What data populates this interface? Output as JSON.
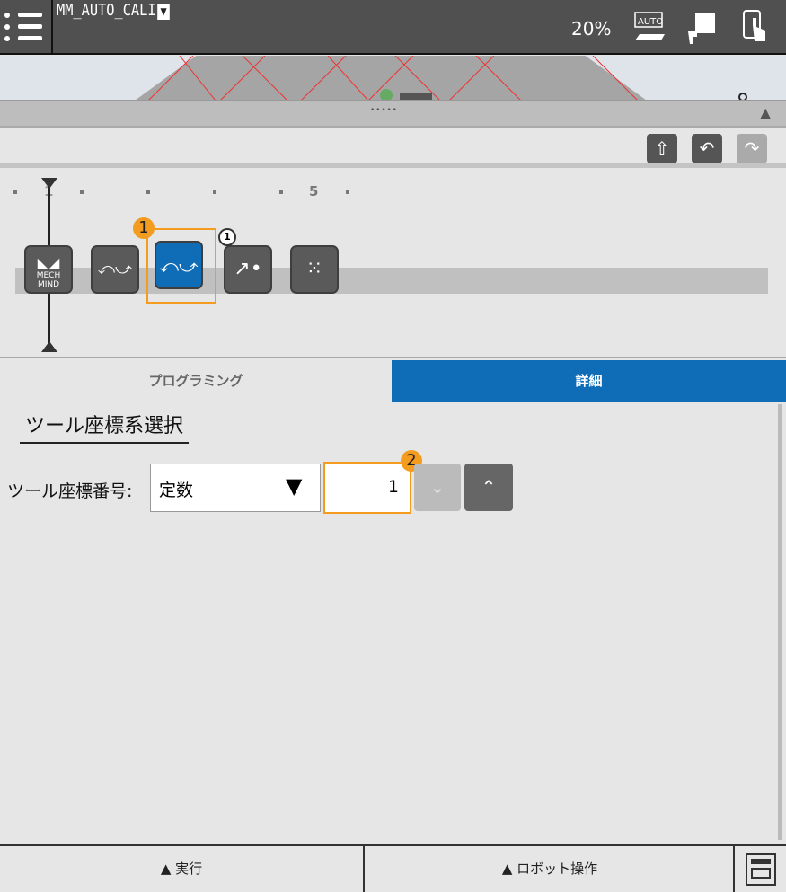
{
  "header": {
    "program_name": "MM_AUTO_CALI",
    "dropdown_glyph": "▼",
    "speed": "20%",
    "icons": [
      "menu-icon",
      "auto-mode-icon",
      "teach-pendant-icon",
      "touch-icon"
    ]
  },
  "splitter": {
    "dots": "• • • • •",
    "collapse_glyph": "▲"
  },
  "toolbar": {
    "icons": [
      "upload-icon",
      "undo-icon",
      "redo-icon"
    ]
  },
  "timeline": {
    "tick_label_1": "1",
    "tick_label_5": "5",
    "nodes": [
      {
        "label": "MECH\nMIND",
        "line1": "MECH",
        "line2": "MIND"
      },
      {
        "label": "calib-switch"
      },
      {
        "label": "tool-switch",
        "selected": true
      },
      {
        "label": "move"
      },
      {
        "label": "pattern"
      }
    ],
    "node_badge": "1",
    "callout_1": "1",
    "callout_2": "2"
  },
  "tabs": {
    "programming": "プログラミング",
    "details": "詳細"
  },
  "detail": {
    "section_title": "ツール座標系選択",
    "field_label": "ツール座標番号:",
    "type_value": "定数",
    "type_glyph": "▼",
    "number_value": "1"
  },
  "bottom": {
    "run": "▲ 実行",
    "robot_op": "▲ ロボット操作"
  },
  "colors": {
    "accent": "#0f6db8",
    "highlight": "#f39c1f",
    "header": "#505050"
  }
}
